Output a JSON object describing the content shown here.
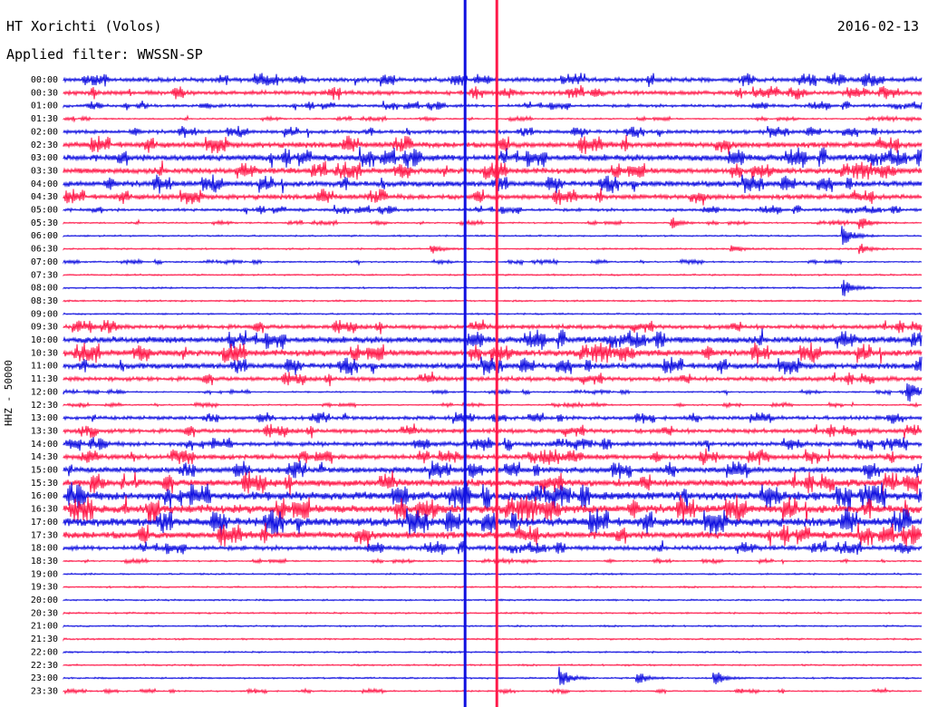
{
  "header": {
    "station": "HT Xorichti (Volos)",
    "date": "2016-02-13",
    "filter": "Applied filter: WWSSN-SP",
    "channel": "HHZ - 50000"
  },
  "colors": {
    "a": "#1010e0",
    "b": "#ff1a4a",
    "bg": "#ffffff"
  },
  "chart_data": {
    "type": "line",
    "title": "HT Xorichti (Volos)",
    "subtitle": "Applied filter: WWSSN-SP",
    "ylabel": "HHZ - 50000",
    "xlabel": "",
    "categories": [
      "00:00",
      "00:30",
      "01:00",
      "01:30",
      "02:00",
      "02:30",
      "03:00",
      "03:30",
      "04:00",
      "04:30",
      "05:00",
      "05:30",
      "06:00",
      "06:30",
      "07:00",
      "07:30",
      "08:00",
      "08:30",
      "09:00",
      "09:30",
      "10:00",
      "10:30",
      "11:00",
      "11:30",
      "12:00",
      "12:30",
      "13:00",
      "13:30",
      "14:00",
      "14:30",
      "15:00",
      "15:30",
      "16:00",
      "16:30",
      "17:00",
      "17:30",
      "18:00",
      "18:30",
      "19:00",
      "19:30",
      "20:00",
      "20:30",
      "21:00",
      "21:30",
      "22:00",
      "22:30",
      "23:00",
      "23:30"
    ],
    "noise_level": [
      6,
      6,
      4,
      2,
      5,
      8,
      9,
      8,
      8,
      7,
      4,
      2,
      1,
      1,
      2,
      1,
      1,
      1,
      1,
      6,
      9,
      9,
      8,
      6,
      2,
      2,
      5,
      6,
      6,
      7,
      8,
      10,
      12,
      12,
      12,
      10,
      6,
      2,
      1,
      1,
      1,
      1,
      1,
      1,
      1,
      1,
      1,
      2
    ],
    "events": [
      {
        "line": "05:30",
        "x": 0.71,
        "amp": 6
      },
      {
        "line": "05:30",
        "x": 0.93,
        "amp": 5
      },
      {
        "line": "06:00",
        "x": 0.91,
        "amp": 10
      },
      {
        "line": "06:30",
        "x": 0.43,
        "amp": 5
      },
      {
        "line": "06:30",
        "x": 0.78,
        "amp": 4
      },
      {
        "line": "06:30",
        "x": 0.93,
        "amp": 5
      },
      {
        "line": "08:00",
        "x": 0.91,
        "amp": 9
      },
      {
        "line": "12:00",
        "x": 0.985,
        "amp": 10
      },
      {
        "line": "23:00",
        "x": 0.58,
        "amp": 12
      },
      {
        "line": "23:00",
        "x": 0.67,
        "amp": 7
      },
      {
        "line": "23:00",
        "x": 0.76,
        "amp": 8
      }
    ],
    "markers": [
      {
        "x": 0.468,
        "color": "#1010e0"
      },
      {
        "x": 0.505,
        "color": "#ff1a4a"
      }
    ],
    "grid": false
  }
}
